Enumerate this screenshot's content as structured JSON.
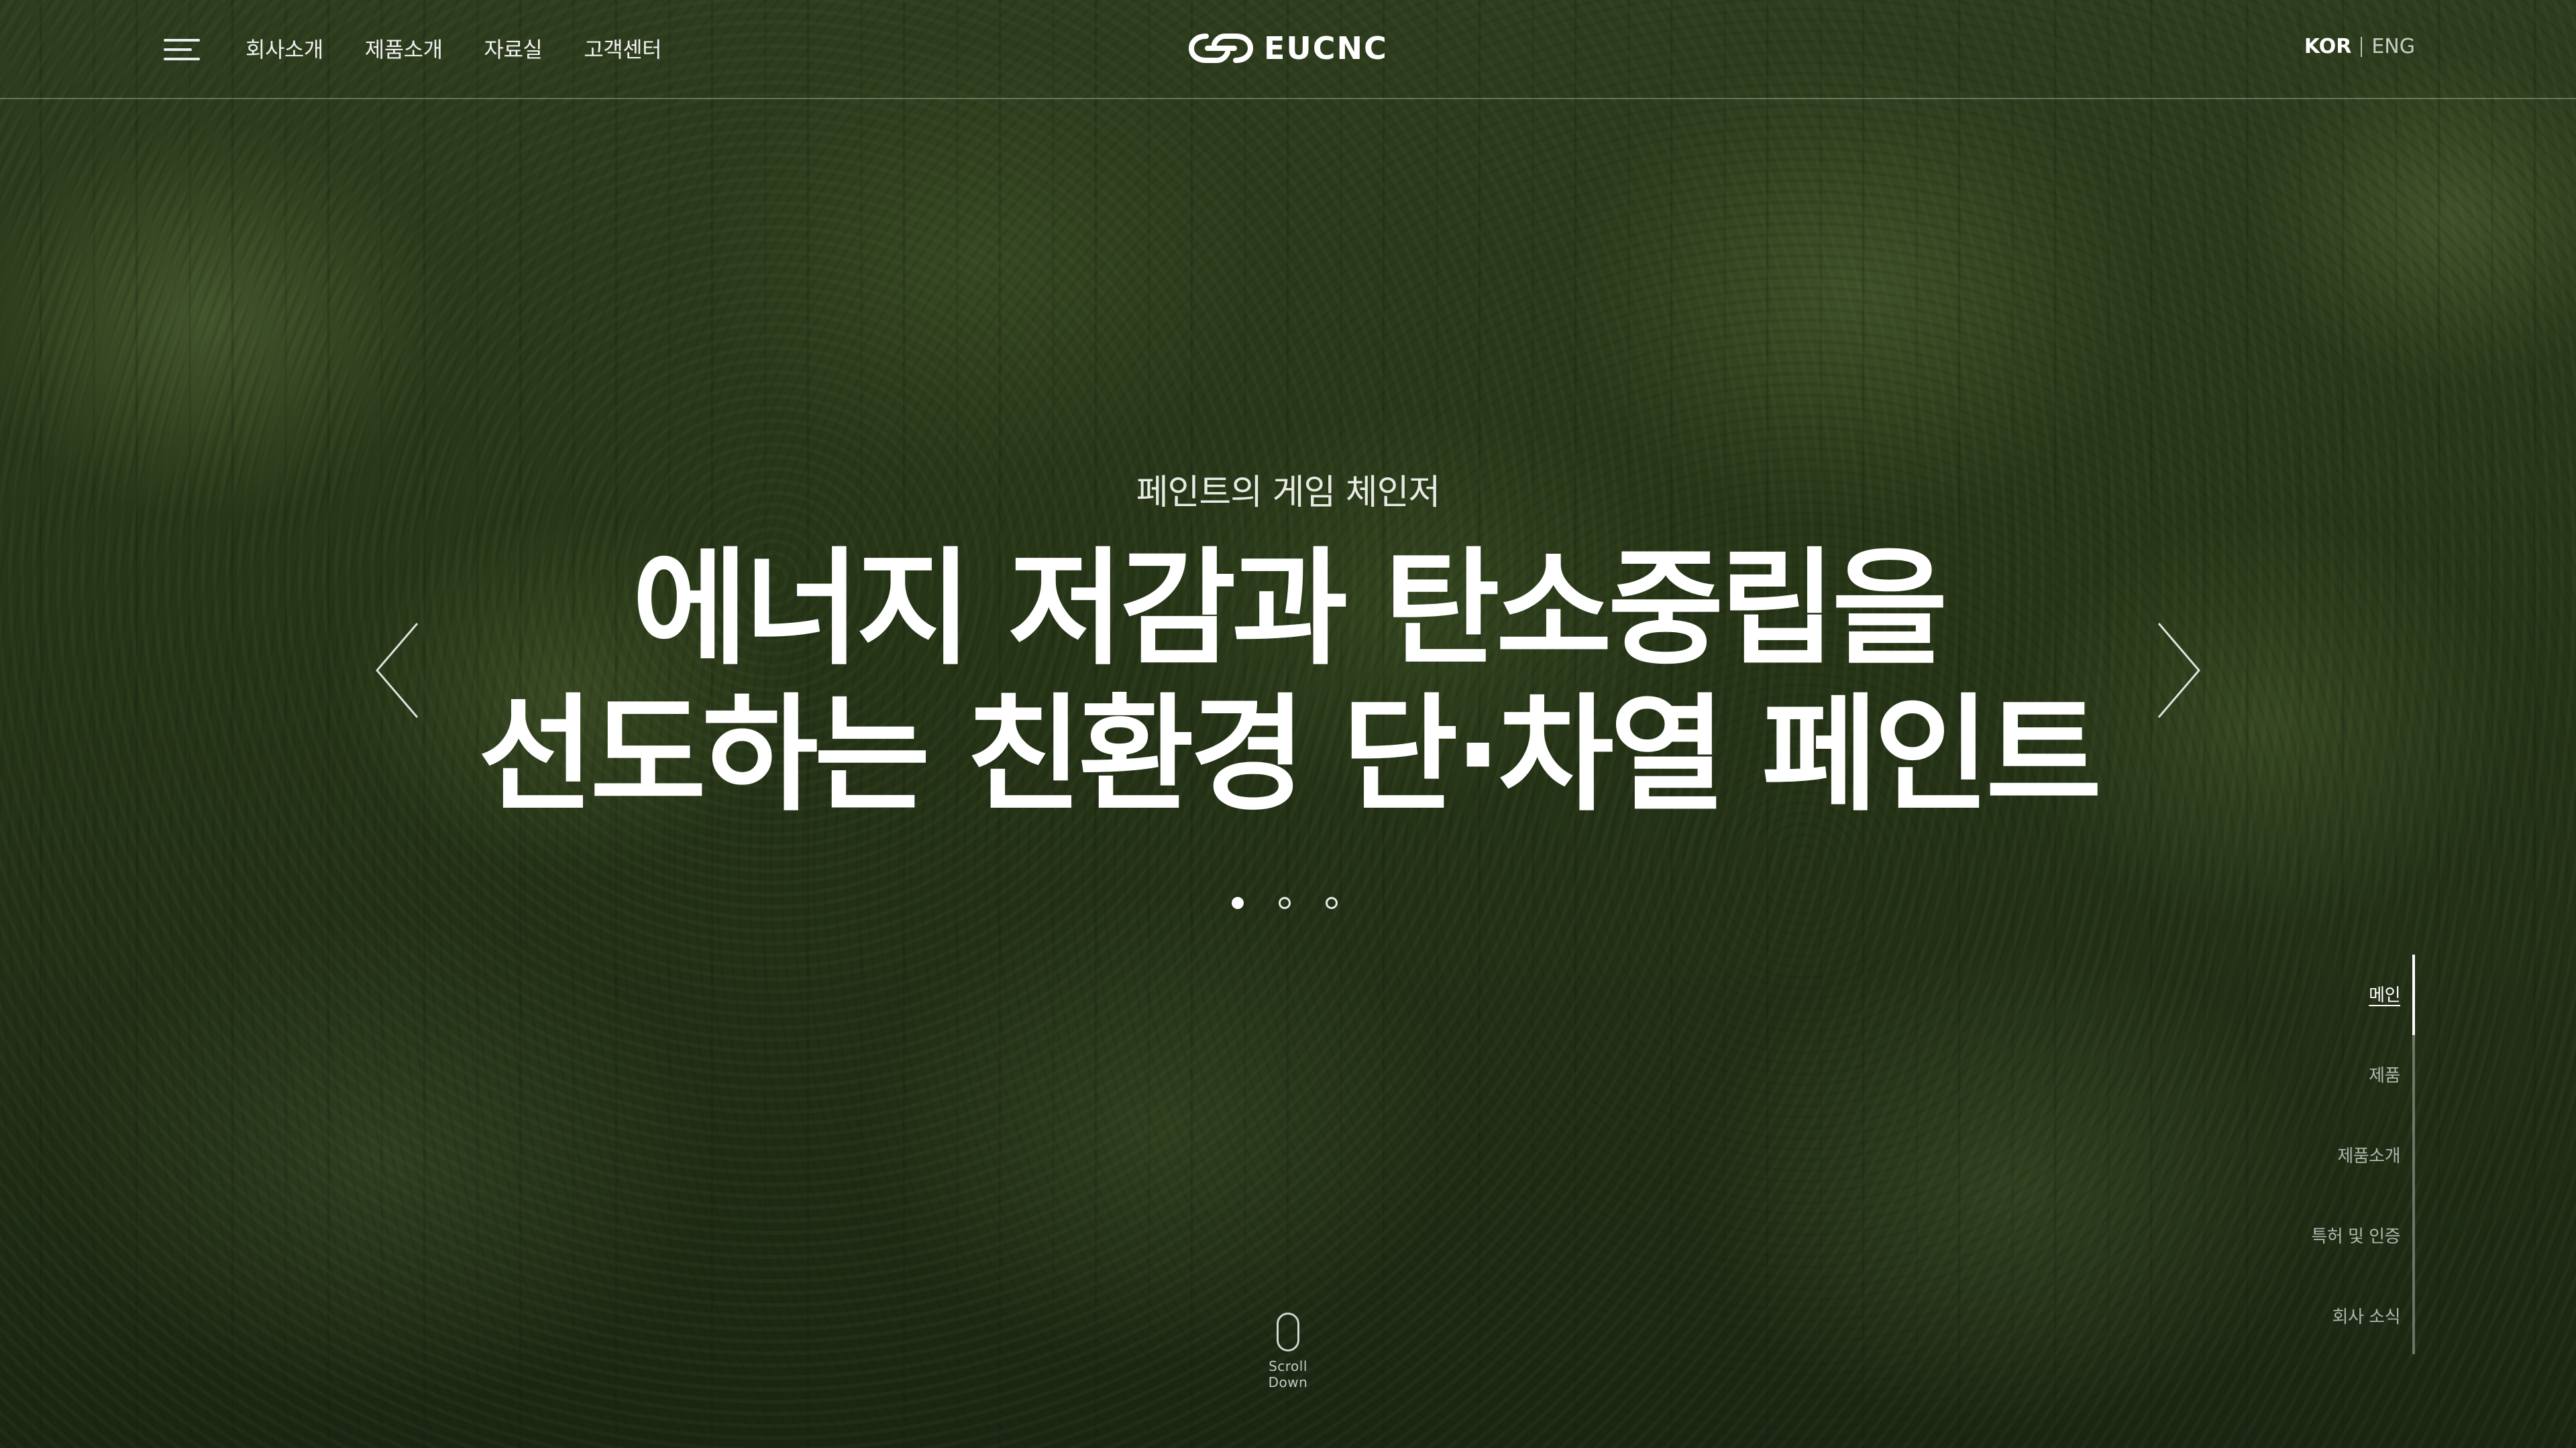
{
  "header": {
    "nav": [
      "회사소개",
      "제품소개",
      "자료실",
      "고객센터"
    ],
    "logo_text": "EUCNC",
    "lang": {
      "kor": "KOR",
      "eng": "ENG"
    }
  },
  "hero": {
    "subtitle": "페인트의 게임 체인저",
    "title_line1": "에너지 저감과 탄소중립을",
    "title_line2": "선도하는 친환경 단·차열 페인트"
  },
  "slider": {
    "slide_count": 3,
    "active_index": 0
  },
  "side_nav": {
    "items": [
      "메인",
      "제품",
      "제품소개",
      "특허 및 인증",
      "회사 소식"
    ],
    "active_index": 0
  },
  "scroll": {
    "label": "Scroll Down"
  },
  "colors": {
    "text": "#ffffff",
    "background_forest": "#34471f"
  },
  "icons": {
    "menu": "hamburger-icon",
    "prev": "chevron-left-icon",
    "next": "chevron-right-icon",
    "scroll": "mouse-icon"
  }
}
